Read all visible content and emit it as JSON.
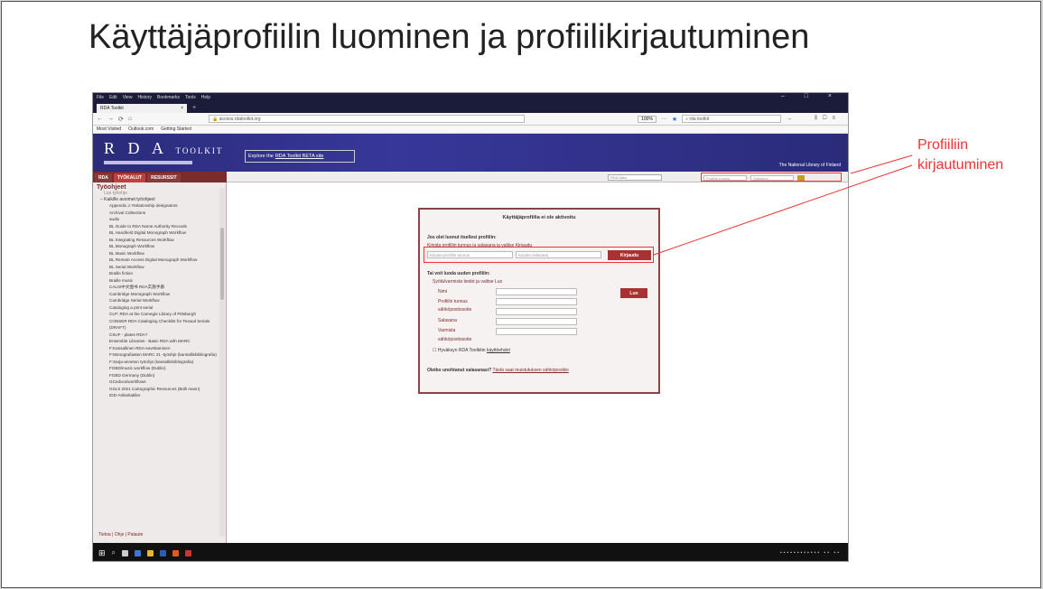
{
  "slide": {
    "title": "Käyttäjäprofiilin luominen ja profiilikirjautuminen",
    "annotation_line1": "Profiiliin",
    "annotation_line2": "kirjautuminen",
    "annotation_color": "#e33333"
  },
  "browser": {
    "menu": [
      "File",
      "Edit",
      "View",
      "History",
      "Bookmarks",
      "Tools",
      "Help"
    ],
    "window_controls": "– □ ×",
    "tab_title": "RDA Toolkit",
    "tab_close": "×",
    "new_tab": "+",
    "url": "access.rdatoolkit.org",
    "zoom": "100%",
    "search_placeholder": "rda toolkit",
    "bookmarks": [
      "Most Visited",
      "Outlook.com",
      "Getting Started"
    ]
  },
  "site": {
    "logo": "R D A",
    "logo_small": "TOOLKIT",
    "explore_text": "Explore the",
    "explore_link": "RDA Toolkit BETA site",
    "library": "The National Library of Finland",
    "tabs": [
      "RDA",
      "TYÖKALUT",
      "RESURSSIT"
    ],
    "active_tab": 1,
    "top_search_placeholder": "RDA haku",
    "top_login_user": "Profiilin tunnus",
    "top_login_pass": "Salasana"
  },
  "sidebar": {
    "title": "Työohjeet",
    "subtitle": "Luo työohje",
    "group": "– Kaikille avoimet työohjeet",
    "items": [
      "Appendix J: Relationship designators",
      "Archival Collections",
      "audio",
      "BL Guide to RDA Name Authority Records",
      "BL Handheld Digital Monograph Workflow",
      "BL Integrating Resources Workflow",
      "BL Monograph Workflow",
      "BL Music Workflow",
      "BL Remote Access Digital Monograph Workflow",
      "BL Serial Workflow",
      "Braille fiction",
      "Braille music",
      "CALIS中文图书 RDA实施手册",
      "Cambridge Monograph Workflow",
      "Cambridge Serial Workflow",
      "Cataloging a print serial",
      "CLP: RDA at the Carnegie Library of Pittsburgh",
      "CONSER RDA Cataloging Checklist for Textual Serials (DRAFT)",
      "CSUF - plates RDA?",
      "Ensemble Libraries - Basic RDA with MARC",
      "F:Kansallinen RDA-soveltaminen",
      "F:Monografiasten MARC 21 -työohje (kansallisbibliografia)",
      "F:Sarja-annetun työohje (kansallisbibliografia)",
      "FGBD/music workflow (Dublin)",
      "FGBD Germany (Dublin)",
      "GCedocs/workflows",
      "GSLS 2021 Cartographic Resources (Bolli mann)",
      "IDD-Artikeltatiller"
    ],
    "footer": "Tietoa | Ohje | Palaute"
  },
  "dialog": {
    "title": "Käyttäjäprofiilia ei ole aktivoitu",
    "existing_heading": "Jos olet luonut itsellesi profiilin:",
    "existing_instr": "Kirjoita profiilin tunnus ja salasana ja valitse Kirjaudu",
    "user_placeholder": "Kirjoita profiilin tunnus",
    "pass_placeholder": "Kirjoita salasana",
    "login_button": "Kirjaudu",
    "new_heading": "Tai voit luoda uuden profiilin:",
    "new_instr": "Syötä/varmista tiedot ja valitse Luo",
    "fields": [
      "Nimi",
      "Profiilin tunnus",
      "sähköpostiosoite",
      "Salasana",
      "Varmista"
    ],
    "field_extra": "sähköpostiosoite",
    "create_button": "Luo",
    "accept_checkbox_label": "Hyväksyn RDA Toolkitin",
    "accept_link": "käyttöehdot",
    "forgot_text": "Oletko unohtanut salasanasi?",
    "forgot_link": "Tästä saat muistutuksen sähköpostiisi"
  }
}
